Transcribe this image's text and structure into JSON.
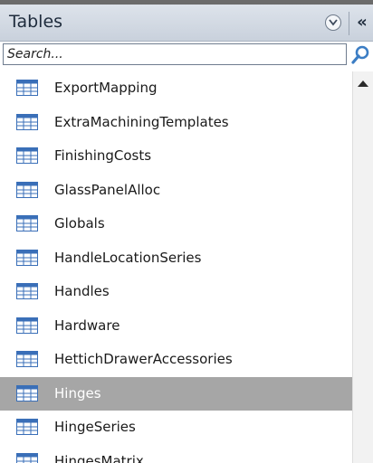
{
  "panel": {
    "title": "Tables",
    "dropdown_icon": "chevron-down-circle-icon",
    "collapse_label": "«"
  },
  "search": {
    "placeholder": "Search...",
    "value": "",
    "icon": "magnifier-icon"
  },
  "list": {
    "item_icon": "table-icon",
    "selected_index": 9,
    "items": [
      {
        "label": "ExportMapping"
      },
      {
        "label": "ExtraMachiningTemplates"
      },
      {
        "label": "FinishingCosts"
      },
      {
        "label": "GlassPanelAlloc"
      },
      {
        "label": "Globals"
      },
      {
        "label": "HandleLocationSeries"
      },
      {
        "label": "Handles"
      },
      {
        "label": "Hardware"
      },
      {
        "label": "HettichDrawerAccessories"
      },
      {
        "label": "Hinges"
      },
      {
        "label": "HingeSeries"
      },
      {
        "label": "HingesMatrix"
      }
    ]
  },
  "scrollbar": {
    "up_icon": "scroll-up-arrow-icon"
  },
  "colors": {
    "header_bg": "#d3dae3",
    "selected_row": "#a6a6a6",
    "icon_blue": "#3a6fb8",
    "search_icon": "#3b7dc4"
  }
}
